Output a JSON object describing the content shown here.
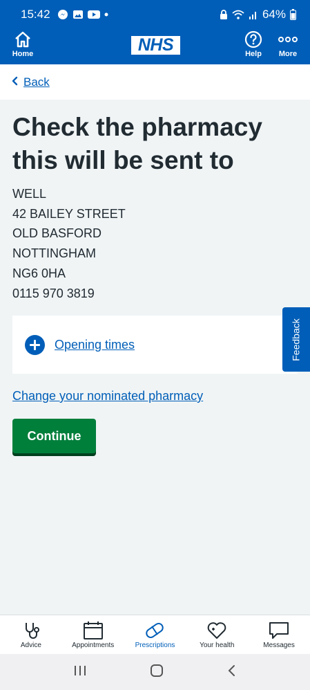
{
  "status_bar": {
    "time": "15:42",
    "battery": "64%"
  },
  "header": {
    "home_label": "Home",
    "logo_text": "NHS",
    "help_label": "Help",
    "more_label": "More"
  },
  "back_label": "Back",
  "title": "Check the pharmacy this will be sent to",
  "address": [
    "WELL",
    "42 BAILEY STREET",
    "OLD BASFORD",
    "NOTTINGHAM",
    "NG6 0HA",
    "0115 970 3819"
  ],
  "details": {
    "label": "Opening times"
  },
  "feedback_label": "Feedback",
  "change_link": "Change your nominated pharmacy",
  "continue_label": "Continue",
  "tabs": [
    {
      "label": "Advice",
      "icon": "stethoscope-icon"
    },
    {
      "label": "Appointments",
      "icon": "calendar-icon"
    },
    {
      "label": "Prescriptions",
      "icon": "pill-icon",
      "active": true
    },
    {
      "label": "Your health",
      "icon": "heart-icon"
    },
    {
      "label": "Messages",
      "icon": "message-icon"
    }
  ],
  "colors": {
    "brand_blue": "#005eb8",
    "button_green": "#007f3b",
    "background": "#f0f4f5"
  }
}
